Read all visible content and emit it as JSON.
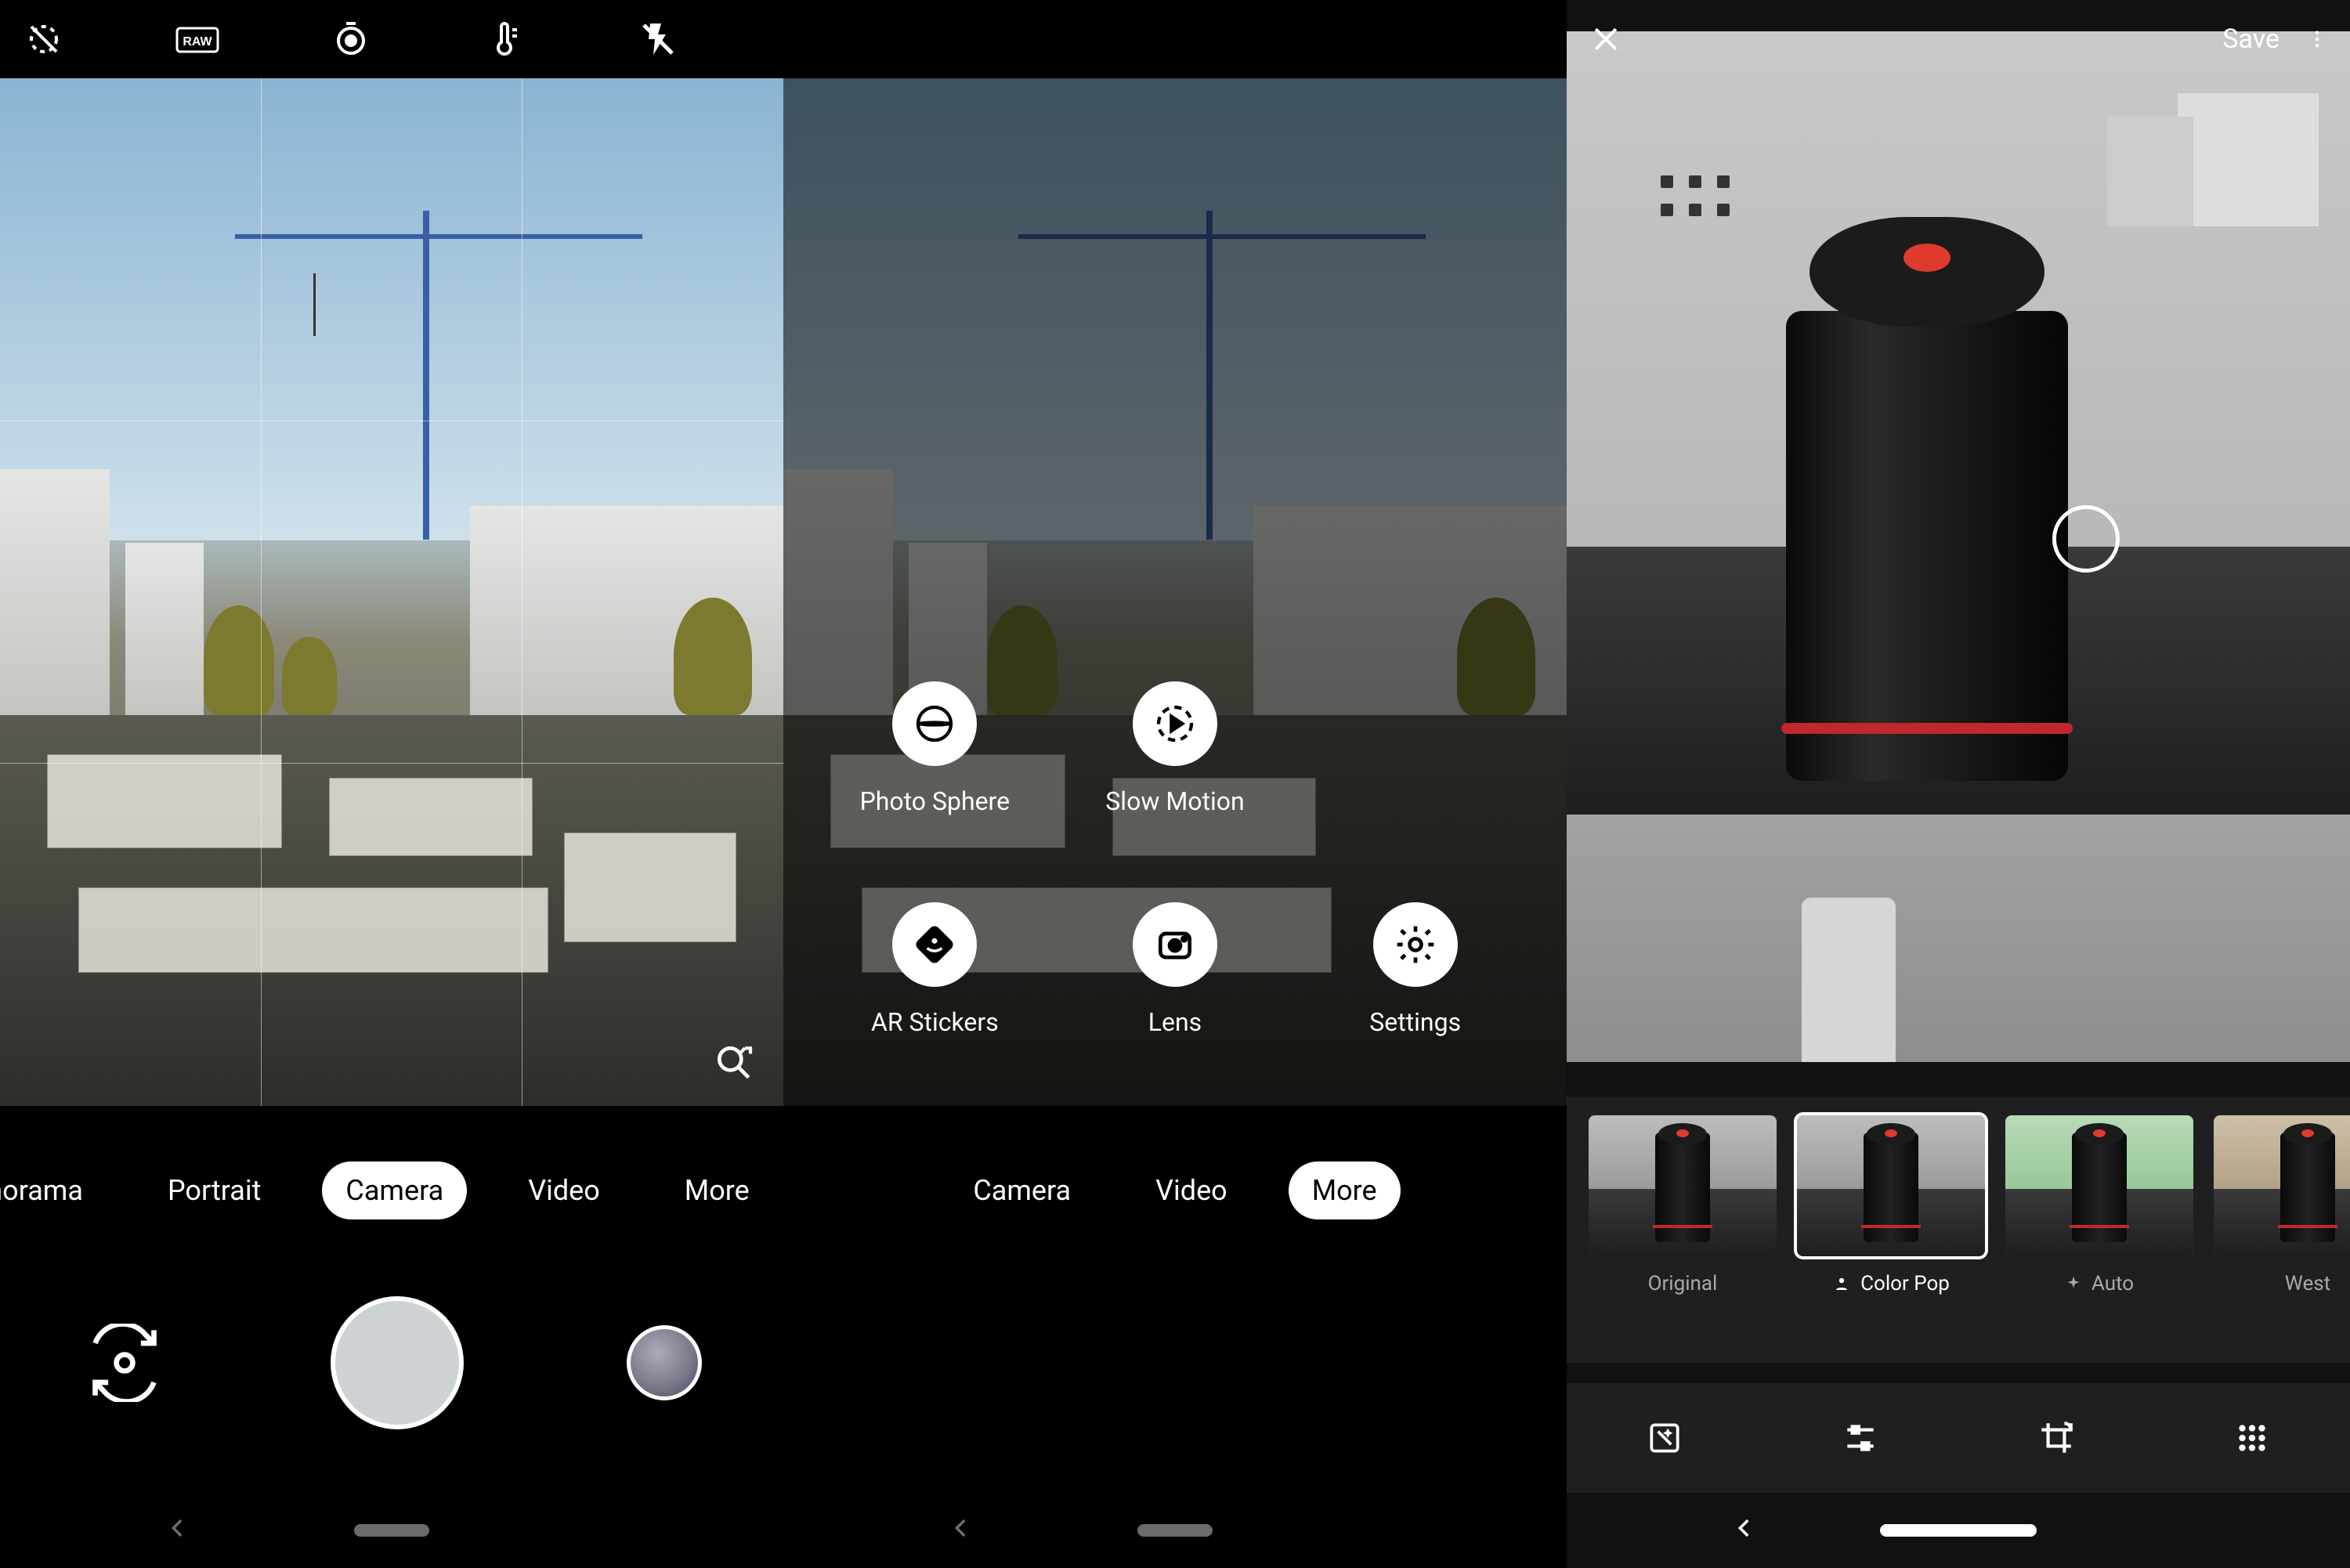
{
  "camera": {
    "topbar_icons": [
      "motion-off-icon",
      "raw-icon",
      "timer-icon",
      "temperature-icon",
      "flash-off-icon"
    ],
    "modes": [
      {
        "label": "norama",
        "active": false
      },
      {
        "label": "Portrait",
        "active": false
      },
      {
        "label": "Camera",
        "active": true
      },
      {
        "label": "Video",
        "active": false
      },
      {
        "label": "More",
        "active": false
      }
    ]
  },
  "more_menu": {
    "modes": [
      {
        "label": "Camera",
        "active": false
      },
      {
        "label": "Video",
        "active": false
      },
      {
        "label": "More",
        "active": true
      }
    ],
    "items": [
      {
        "label": "Photo Sphere",
        "icon": "photosphere-icon"
      },
      {
        "label": "Slow Motion",
        "icon": "slowmotion-icon"
      },
      {
        "label": "AR Stickers",
        "icon": "arstickers-icon"
      },
      {
        "label": "Lens",
        "icon": "lens-icon"
      },
      {
        "label": "Settings",
        "icon": "settings-icon"
      }
    ]
  },
  "editor": {
    "save_label": "Save",
    "filters": [
      {
        "label": "Original",
        "selected": false,
        "prefix_icon": null
      },
      {
        "label": "Color Pop",
        "selected": true,
        "prefix_icon": "person-icon"
      },
      {
        "label": "Auto",
        "selected": false,
        "prefix_icon": "sparkle-icon"
      },
      {
        "label": "West",
        "selected": false,
        "prefix_icon": null
      }
    ],
    "tools": [
      "enhance-icon",
      "sliders-icon",
      "crop-rotate-icon",
      "grid-icon"
    ]
  }
}
